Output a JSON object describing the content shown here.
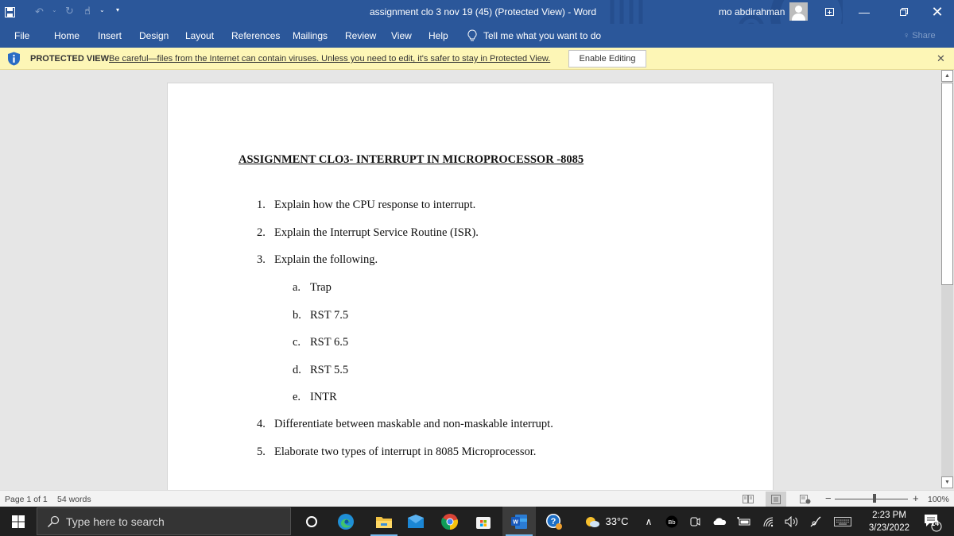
{
  "window": {
    "title": "assignment clo 3 nov 19 (45) (Protected View)  -  Word",
    "user_name": "mo abdirahman",
    "quick_access": [
      {
        "icon": "save-icon"
      },
      {
        "icon": "undo-icon"
      },
      {
        "icon": "redo-icon"
      },
      {
        "icon": "touch-mode-icon"
      },
      {
        "icon": "customize-qat-icon"
      }
    ],
    "controls": {
      "ribbon_display": "ribbon-display-options-icon",
      "minimize": "minimize-icon",
      "restore": "restore-icon",
      "close": "close-icon"
    }
  },
  "ribbon": {
    "tabs": [
      "File",
      "Home",
      "Insert",
      "Design",
      "Layout",
      "References",
      "Mailings",
      "Review",
      "View",
      "Help"
    ],
    "tell_me": "Tell me what you want to do",
    "share": "Share"
  },
  "protected_view": {
    "label": "PROTECTED VIEW",
    "message": "Be careful—files from the Internet can contain viruses. Unless you need to edit, it's safer to stay in Protected View.",
    "enable_button": "Enable Editing"
  },
  "document": {
    "title": "ASSIGNMENT CLO3- INTERRUPT IN MICROPROCESSOR -8085",
    "questions": [
      {
        "num": "1.",
        "text": "Explain how the CPU response to interrupt."
      },
      {
        "num": "2.",
        "text": "Explain the Interrupt Service Routine (ISR)."
      },
      {
        "num": "3.",
        "text": "Explain the following."
      },
      {
        "num": "4.",
        "text": "Differentiate between maskable and non-maskable interrupt."
      },
      {
        "num": "5.",
        "text": "Elaborate two types of interrupt in 8085 Microprocessor."
      }
    ],
    "subitems": [
      {
        "num": "a.",
        "text": "Trap"
      },
      {
        "num": "b.",
        "text": "RST 7.5"
      },
      {
        "num": "c.",
        "text": "RST 6.5"
      },
      {
        "num": "d.",
        "text": "RST 5.5"
      },
      {
        "num": "e.",
        "text": "INTR"
      }
    ]
  },
  "status_bar": {
    "page": "Page 1 of 1",
    "words": "54 words",
    "zoom": "100%",
    "zoom_level_percent": 100,
    "active_view": "print-layout"
  },
  "taskbar": {
    "search_placeholder": "Type here to search",
    "apps": [
      "cortana",
      "edge",
      "file-explorer",
      "mail",
      "chrome",
      "microsoft-store",
      "word",
      "help"
    ],
    "active_app": "word",
    "weather": "33°C",
    "time": "2:23 PM",
    "date": "3/23/2022",
    "notifications": "14"
  }
}
